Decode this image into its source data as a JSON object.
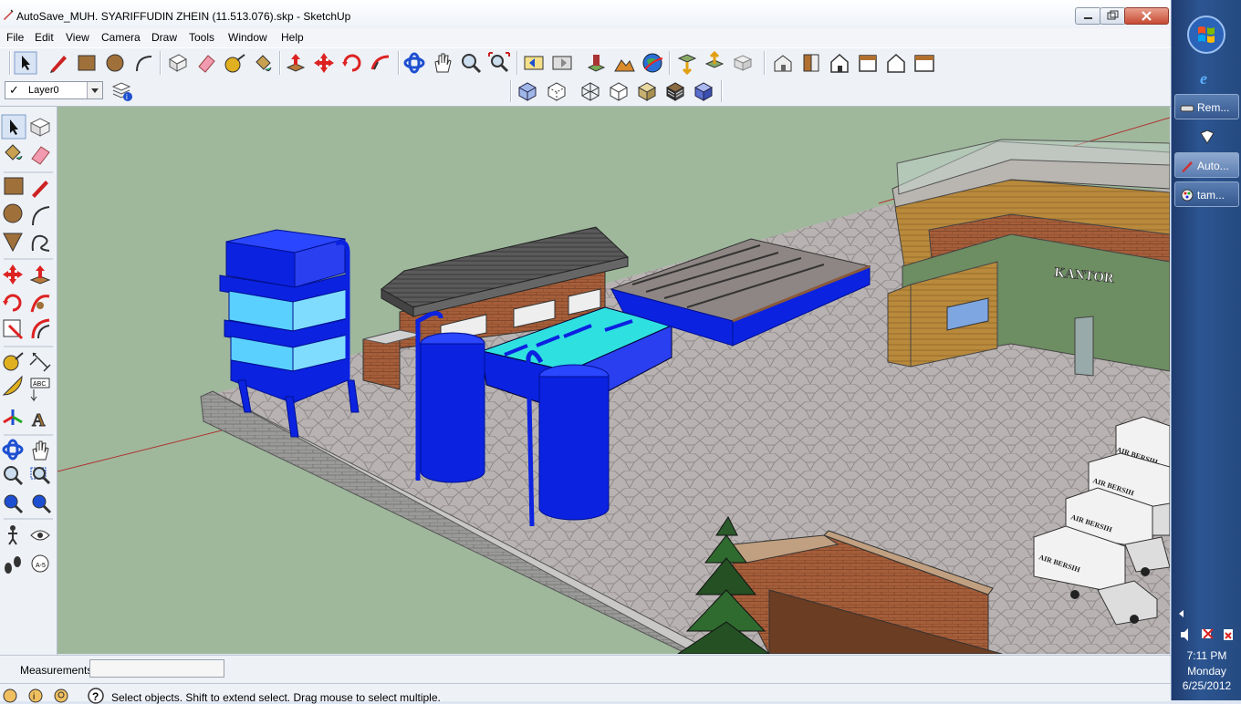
{
  "window": {
    "title": "AutoSave_MUH. SYARIFFUDIN ZHEIN (11.513.076).skp - SketchUp"
  },
  "menu": [
    "File",
    "Edit",
    "View",
    "Camera",
    "Draw",
    "Tools",
    "Window",
    "Help"
  ],
  "layer": {
    "check": "✓",
    "name": "Layer0"
  },
  "model": {
    "office_sign": "KANTOR",
    "truck_label": "AIR BERSIH"
  },
  "status": {
    "measurements_label": "Measurements",
    "measurements_value": "",
    "hint": "Select objects. Shift to extend select. Drag mouse to select multiple."
  },
  "taskbar": {
    "items": [
      {
        "label": "Rem..."
      },
      {
        "label": "Auto..."
      },
      {
        "label": "tam..."
      }
    ],
    "clock": {
      "time": "7:11 PM",
      "day": "Monday",
      "date": "6/25/2012"
    }
  },
  "colors": {
    "sky": "#9fb89c",
    "ground_paving": "#b3aeae",
    "blue_structures": "#0a1fe0",
    "axis_red": "#b03030",
    "taskbar": "#2c5591"
  }
}
